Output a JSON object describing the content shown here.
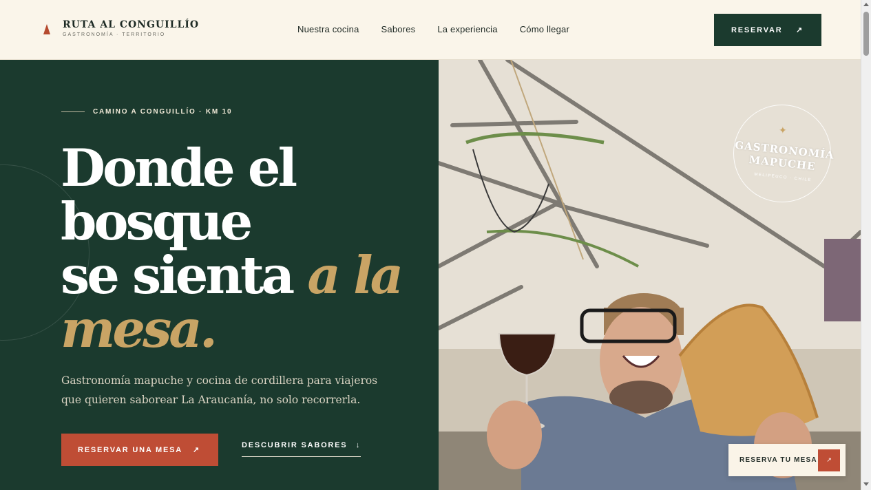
{
  "brand": {
    "name": "RUTA AL CONGUILLÍO",
    "tagline": "GASTRONOMÍA · TERRITORIO",
    "mark_color": "#b54a2f"
  },
  "nav": {
    "items": [
      {
        "label": "Nuestra cocina"
      },
      {
        "label": "Sabores"
      },
      {
        "label": "La experiencia"
      },
      {
        "label": "Cómo llegar"
      }
    ]
  },
  "header": {
    "reserve_label": "RESERVAR",
    "reserve_icon": "↗"
  },
  "hero": {
    "eyebrow": "CAMINO A CONGUILLÍO · KM 10",
    "headline_line1": "Donde el",
    "headline_line2": "bosque",
    "headline_line3": "se sienta",
    "headline_accent1": "a la",
    "headline_accent2": "mesa.",
    "lead": "Gastronomía mapuche y cocina de cordillera para viajeros que quieren saborear La Araucanía, no solo recorrerla.",
    "primary_cta": "RESERVAR UNA MESA",
    "primary_icon": "↗",
    "secondary_cta": "DESCUBRIR SABORES",
    "secondary_icon": "↓"
  },
  "badge": {
    "star": "✦",
    "title_line1": "GASTRONOMÍA",
    "title_line2": "MAPUCHE",
    "subtitle": "MELIPEUCO · CHILE"
  },
  "floating_card": {
    "label": "RESERVA TU MESA",
    "icon": "↗"
  },
  "colors": {
    "forest": "#1b3a2e",
    "terracotta": "#bf4d35",
    "gold": "#c9a465",
    "cream": "#faf5ea"
  }
}
